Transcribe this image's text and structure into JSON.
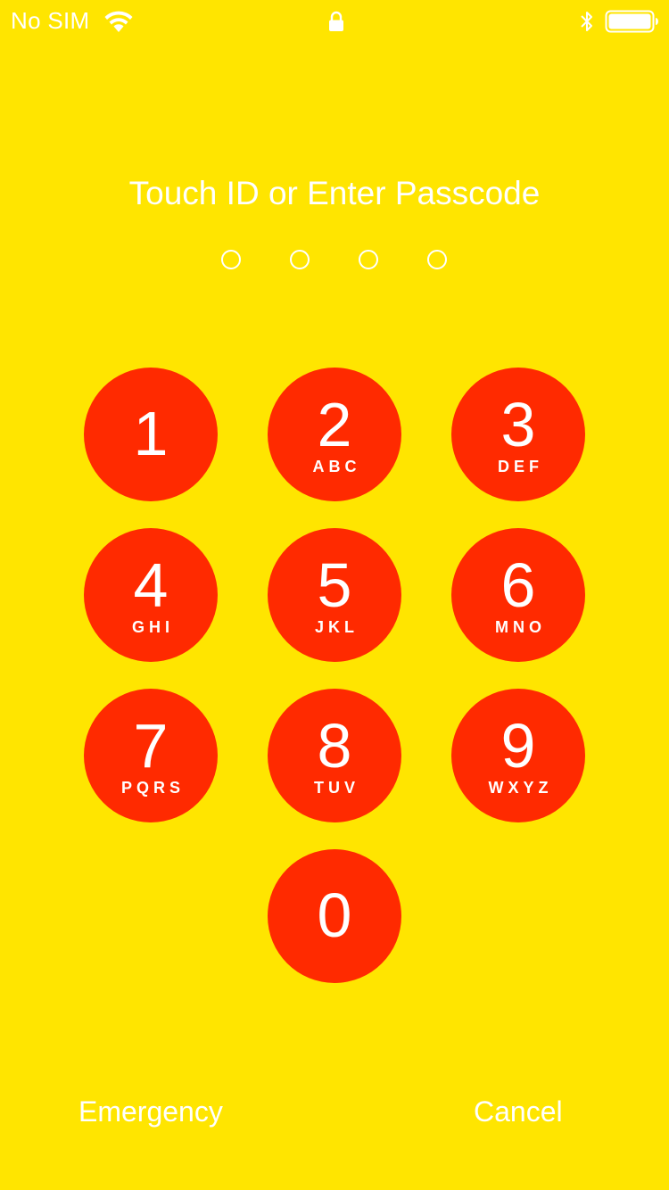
{
  "status_bar": {
    "carrier": "No SIM",
    "icons": [
      "wifi-icon",
      "lock-icon",
      "bluetooth-icon",
      "battery-icon"
    ],
    "battery_level": 1.0
  },
  "title": "Touch ID or Enter Passcode",
  "passcode": {
    "length": 4,
    "entered": 0
  },
  "keypad": {
    "keys": [
      {
        "digit": "1",
        "letters": ""
      },
      {
        "digit": "2",
        "letters": "ABC"
      },
      {
        "digit": "3",
        "letters": "DEF"
      },
      {
        "digit": "4",
        "letters": "GHI"
      },
      {
        "digit": "5",
        "letters": "JKL"
      },
      {
        "digit": "6",
        "letters": "MNO"
      },
      {
        "digit": "7",
        "letters": "PQRS"
      },
      {
        "digit": "8",
        "letters": "TUV"
      },
      {
        "digit": "9",
        "letters": "WXYZ"
      },
      {
        "digit": "0",
        "letters": ""
      }
    ]
  },
  "buttons": {
    "emergency": "Emergency",
    "cancel": "Cancel"
  },
  "colors": {
    "background": "#FFE500",
    "key": "#FF2A00",
    "text": "#FFFFFF"
  }
}
